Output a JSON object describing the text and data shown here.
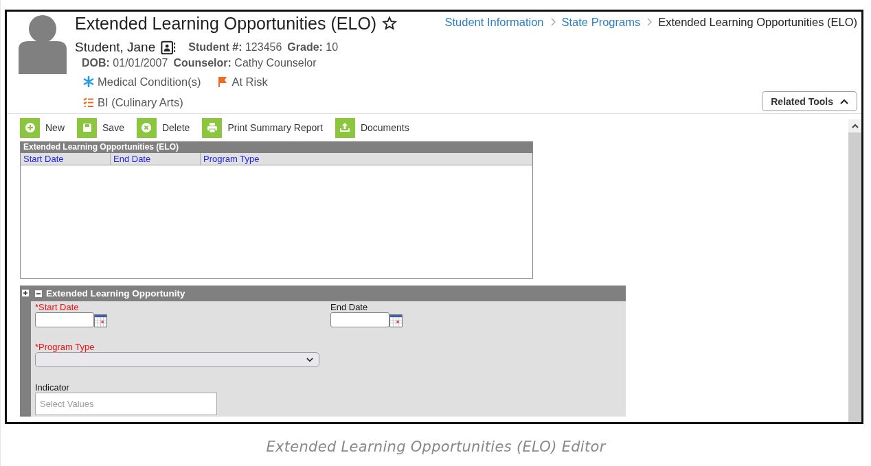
{
  "header": {
    "title": "Extended Learning Opportunities (ELO)",
    "breadcrumb": [
      {
        "label": "Student Information",
        "kind": "link"
      },
      {
        "label": "State Programs",
        "kind": "link"
      },
      {
        "label": "Extended Learning Opportunities (ELO)",
        "kind": "current"
      }
    ],
    "student_name": "Student, Jane",
    "info_line_1": [
      {
        "label": "Student #:",
        "value": "123456"
      },
      {
        "label": "Grade:",
        "value": "10"
      }
    ],
    "info_line_2": [
      {
        "label": "DOB:",
        "value": "01/01/2007"
      },
      {
        "label": "Counselor:",
        "value": "Cathy Counselor"
      }
    ],
    "flags": [
      {
        "label": "Medical Condition(s)",
        "kind": "medical"
      },
      {
        "label": "At Risk",
        "kind": "at_risk"
      }
    ],
    "programs": [
      {
        "label": "BI (Culinary Arts)",
        "kind": "program"
      }
    ],
    "related_tools": {
      "label": "Related Tools",
      "expanded": true
    }
  },
  "toolbar": [
    {
      "label": "New",
      "kind": "new"
    },
    {
      "label": "Save",
      "kind": "save"
    },
    {
      "label": "Delete",
      "kind": "delete"
    },
    {
      "label": "Print Summary Report",
      "kind": "print"
    },
    {
      "label": "Documents",
      "kind": "documents"
    }
  ],
  "list": {
    "title": "Extended Learning Opportunities (ELO)",
    "columns": [
      "Start Date",
      "End Date",
      "Program Type"
    ]
  },
  "editor": {
    "title": "Extended Learning Opportunity",
    "expanded": true,
    "rows": [
      [
        {
          "label": "*Start Date",
          "required": true,
          "kind": "date"
        },
        {
          "label": "End Date",
          "required": false,
          "kind": "date"
        }
      ],
      [
        {
          "label": "*Program Type",
          "required": true,
          "kind": "select"
        }
      ],
      [
        {
          "label": "Indicator",
          "required": false,
          "kind": "multiselect",
          "placeholder": "Select Values"
        }
      ]
    ]
  },
  "caption": "Extended Learning Opportunities (ELO) Editor"
}
